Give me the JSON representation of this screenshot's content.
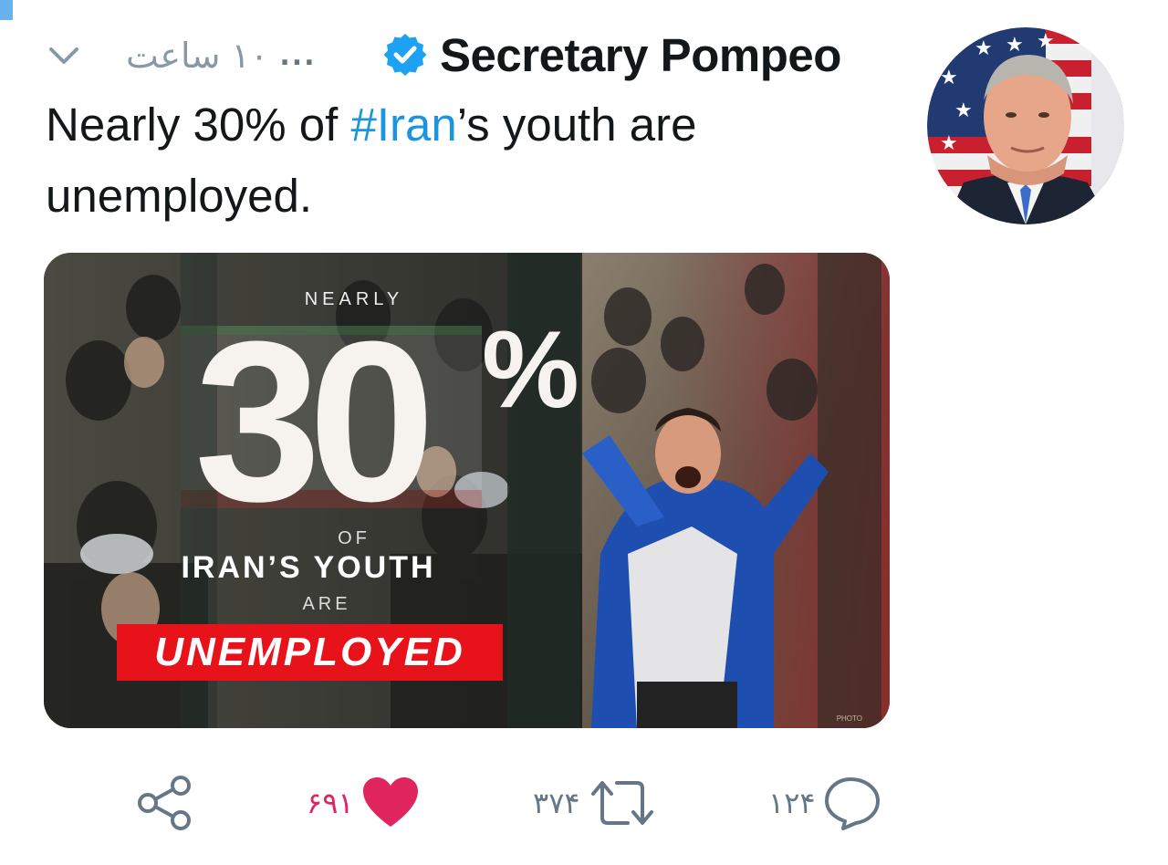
{
  "tweet": {
    "display_name": "Secretary Pompeo",
    "verified": true,
    "ellipsis": "...",
    "time": "۱۰ ساعت",
    "text_before": "Nearly 30% of ",
    "hashtag": "#Iran",
    "text_after": "’s youth are unemployed."
  },
  "media": {
    "nearly": "NEARLY",
    "big_number": "30",
    "percent": "%",
    "of": "OF",
    "iran_youth": "IRAN’S YOUTH",
    "are": "ARE",
    "unemployed": "UNEMPLOYED",
    "photo_credit": "PHOTO",
    "accent_color": "#e8121b"
  },
  "actions": {
    "share_icon": "share-icon",
    "like_count": "۶۹۱",
    "like_icon": "heart-icon",
    "like_color": "#e0245e",
    "retweet_count": "۳۷۴",
    "retweet_icon": "retweet-icon",
    "reply_count": "۱۲۴",
    "reply_icon": "reply-icon",
    "icon_color": "#657786"
  },
  "colors": {
    "link": "#1b95e0",
    "verified": "#1da1f2",
    "text": "#14171a",
    "muted": "#8899a6"
  }
}
